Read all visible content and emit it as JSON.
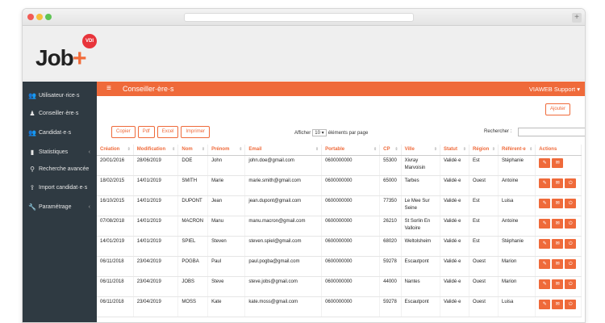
{
  "brand": {
    "logo_text": "Job",
    "logo_badge": "VDI",
    "logo_plus": "+"
  },
  "sidebar": {
    "items": [
      {
        "label": "Utilisateur·rice·s",
        "icon": "users-icon",
        "has_caret": false
      },
      {
        "label": "Conseiller·ère·s",
        "icon": "person-icon",
        "has_caret": false
      },
      {
        "label": "Candidat·e·s",
        "icon": "group-icon",
        "has_caret": false
      },
      {
        "label": "Statistiques",
        "icon": "bar-chart-icon",
        "has_caret": true
      },
      {
        "label": "Recherche avancée",
        "icon": "search-icon",
        "has_caret": false
      },
      {
        "label": "Import candidat·e·s",
        "icon": "upload-icon",
        "has_caret": false
      },
      {
        "label": "Paramétrage",
        "icon": "wrench-icon",
        "has_caret": true
      }
    ]
  },
  "topnav": {
    "title": "Conseiller·ère·s",
    "user": "VIAWEB Support",
    "accent": "#ef6a3a"
  },
  "toolbar": {
    "add_label": "Ajouter",
    "export_buttons": [
      "Copier",
      "Pdf",
      "Excel",
      "Imprimer"
    ],
    "show_prefix": "Afficher",
    "page_size": "10",
    "show_suffix": "éléments par page",
    "search_label": "Rechercher :"
  },
  "table": {
    "columns": [
      "Création",
      "Modification",
      "Nom",
      "Prénom",
      "Email",
      "Portable",
      "CP",
      "Ville",
      "Statut",
      "Région",
      "Référent·e",
      "Actions"
    ],
    "rows": [
      {
        "creation": "20/01/2016",
        "modification": "28/06/2019",
        "nom": "DOE",
        "prenom": "John",
        "email": "john.doe@gmail.com",
        "portable": "0600000000",
        "cp": "55300",
        "ville": "Xivray Marvoisin",
        "statut": "Validé·e",
        "region": "Est",
        "referent": "Stéphanie",
        "actions": [
          "pencil-icon",
          "envelope-icon"
        ]
      },
      {
        "creation": "18/02/2015",
        "modification": "14/01/2019",
        "nom": "SMITH",
        "prenom": "Marie",
        "email": "marie.smith@gmail.com",
        "portable": "0600000000",
        "cp": "65000",
        "ville": "Tarbes",
        "statut": "Validé·e",
        "region": "Ouest",
        "referent": "Antoine",
        "actions": [
          "pencil-icon",
          "envelope-icon",
          "power-icon"
        ]
      },
      {
        "creation": "16/10/2015",
        "modification": "14/01/2019",
        "nom": "DUPONT",
        "prenom": "Jean",
        "email": "jean.dupont@gmail.com",
        "portable": "0600000000",
        "cp": "77350",
        "ville": "Le Mee Sur Seine",
        "statut": "Validé·e",
        "region": "Est",
        "referent": "Luisa",
        "actions": [
          "pencil-icon",
          "envelope-icon",
          "power-icon"
        ]
      },
      {
        "creation": "07/08/2018",
        "modification": "14/01/2019",
        "nom": "MACRON",
        "prenom": "Manu",
        "email": "manu.macron@gmail.com",
        "portable": "0600000000",
        "cp": "26210",
        "ville": "St Sorlin En Valloire",
        "statut": "Validé·e",
        "region": "Est",
        "referent": "Antoine",
        "actions": [
          "pencil-icon",
          "envelope-icon",
          "power-icon"
        ]
      },
      {
        "creation": "14/01/2019",
        "modification": "14/01/2019",
        "nom": "SPIEL",
        "prenom": "Steven",
        "email": "steven.spiel@gmail.com",
        "portable": "0600000000",
        "cp": "68020",
        "ville": "Weltolsheim",
        "statut": "Validé·e",
        "region": "Est",
        "referent": "Stéphanie",
        "actions": [
          "pencil-icon",
          "envelope-icon",
          "power-icon"
        ]
      },
      {
        "creation": "06/11/2018",
        "modification": "23/04/2019",
        "nom": "POGBA",
        "prenom": "Paul",
        "email": "paul.pogba@gmail.com",
        "portable": "0600000000",
        "cp": "59278",
        "ville": "Escautpont",
        "statut": "Validé·e",
        "region": "Ouest",
        "referent": "Marion",
        "actions": [
          "pencil-icon",
          "envelope-icon",
          "power-icon"
        ]
      },
      {
        "creation": "06/11/2018",
        "modification": "23/04/2019",
        "nom": "JOBS",
        "prenom": "Steve",
        "email": "steve.jobs@gmail.com",
        "portable": "0600000000",
        "cp": "44000",
        "ville": "Nantes",
        "statut": "Validé·e",
        "region": "Ouest",
        "referent": "Marion",
        "actions": [
          "pencil-icon",
          "envelope-icon",
          "power-icon"
        ]
      },
      {
        "creation": "06/11/2018",
        "modification": "23/04/2019",
        "nom": "MOSS",
        "prenom": "Kate",
        "email": "kate.moss@gmail.com",
        "portable": "0600000000",
        "cp": "59278",
        "ville": "Escautpont",
        "statut": "Validé·e",
        "region": "Ouest",
        "referent": "Luisa",
        "actions": [
          "pencil-icon",
          "envelope-icon",
          "power-icon"
        ]
      }
    ]
  }
}
